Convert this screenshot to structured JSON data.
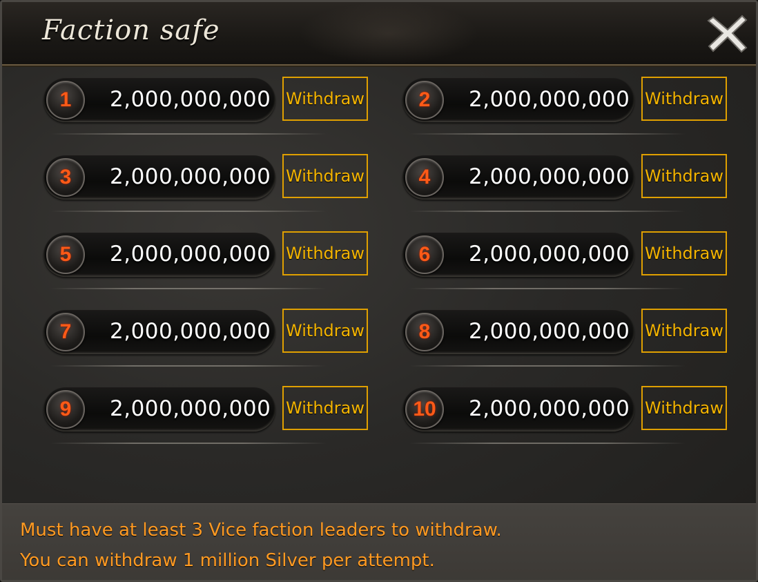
{
  "window": {
    "title": "Faction safe",
    "close_icon": "close-x-icon"
  },
  "safes": [
    {
      "slot": "1",
      "amount": "2,000,000,000",
      "button": "Withdraw"
    },
    {
      "slot": "2",
      "amount": "2,000,000,000",
      "button": "Withdraw"
    },
    {
      "slot": "3",
      "amount": "2,000,000,000",
      "button": "Withdraw"
    },
    {
      "slot": "4",
      "amount": "2,000,000,000",
      "button": "Withdraw"
    },
    {
      "slot": "5",
      "amount": "2,000,000,000",
      "button": "Withdraw"
    },
    {
      "slot": "6",
      "amount": "2,000,000,000",
      "button": "Withdraw"
    },
    {
      "slot": "7",
      "amount": "2,000,000,000",
      "button": "Withdraw"
    },
    {
      "slot": "8",
      "amount": "2,000,000,000",
      "button": "Withdraw"
    },
    {
      "slot": "9",
      "amount": "2,000,000,000",
      "button": "Withdraw"
    },
    {
      "slot": "10",
      "amount": "2,000,000,000",
      "button": "Withdraw"
    }
  ],
  "footer": {
    "line1": "Must have at least 3 Vice faction leaders to withdraw.",
    "line2": "You can withdraw 1 million Silver per attempt."
  },
  "colors": {
    "slot_number": "#ff5a17",
    "withdraw_border": "#e0a000",
    "withdraw_text": "#f4b400",
    "footer_text": "#ff9a22"
  }
}
